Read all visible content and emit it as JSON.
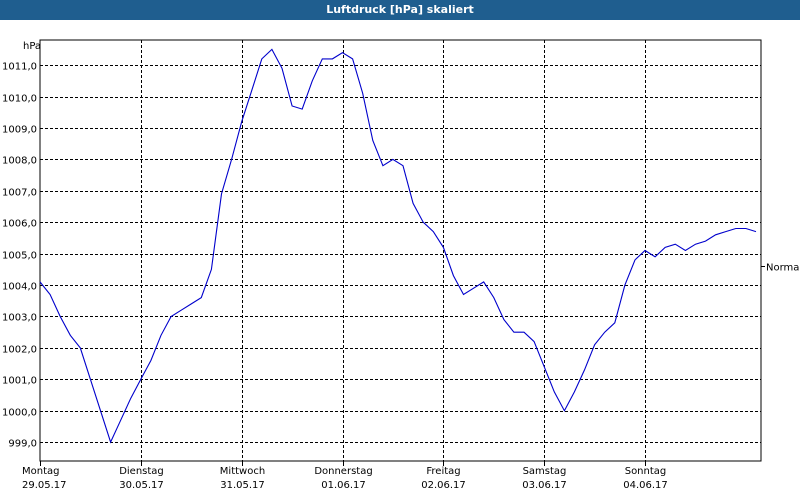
{
  "window": {
    "title": "Luftdruck [hPa] skaliert"
  },
  "chart_data": {
    "type": "line",
    "title": "Luftdruck [hPa] skaliert",
    "ylabel": "hPa",
    "ylim": [
      998.4,
      1011.8
    ],
    "yticks": [
      "999,0",
      "1000,0",
      "1001,0",
      "1002,0",
      "1003,0",
      "1004,0",
      "1005,0",
      "1006,0",
      "1007,0",
      "1008,0",
      "1009,0",
      "1010,0",
      "1011,0"
    ],
    "ytick_values": [
      999,
      1000,
      1001,
      1002,
      1003,
      1004,
      1005,
      1006,
      1007,
      1008,
      1009,
      1010,
      1011
    ],
    "xlim": [
      0,
      7.15
    ],
    "xticks": [
      {
        "day": "Montag",
        "date": "29.05.17"
      },
      {
        "day": "Dienstag",
        "date": "30.05.17"
      },
      {
        "day": "Mittwoch",
        "date": "31.05.17"
      },
      {
        "day": "Donnerstag",
        "date": "01.06.17"
      },
      {
        "day": "Freitag",
        "date": "02.06.17"
      },
      {
        "day": "Samstag",
        "date": "03.06.17"
      },
      {
        "day": "Sonntag",
        "date": "04.06.17"
      }
    ],
    "grid": true,
    "reference_label": "Normal",
    "reference_value": 1004.6,
    "series_color": "#0000cc",
    "series": [
      {
        "x": [
          0,
          0.1,
          0.2,
          0.3,
          0.4,
          0.5,
          0.6,
          0.7,
          0.8,
          0.9,
          1.0,
          1.1,
          1.2,
          1.3,
          1.4,
          1.5,
          1.6,
          1.7,
          1.8,
          1.9,
          2.0,
          2.1,
          2.2,
          2.3,
          2.4,
          2.5,
          2.6,
          2.7,
          2.8,
          2.9,
          3.0,
          3.1,
          3.2,
          3.3,
          3.4,
          3.5,
          3.6,
          3.7,
          3.8,
          3.9,
          4.0,
          4.1,
          4.2,
          4.3,
          4.4,
          4.5,
          4.6,
          4.7,
          4.8,
          4.9,
          5.0,
          5.1,
          5.2,
          5.3,
          5.4,
          5.5,
          5.6,
          5.7,
          5.8,
          5.9,
          6.0,
          6.1,
          6.2,
          6.3,
          6.4,
          6.5,
          6.6,
          6.7,
          6.8,
          6.9,
          7.0,
          7.1
        ],
        "y": [
          1004.1,
          1003.7,
          1003.0,
          1002.4,
          1002.0,
          1001.0,
          1000.0,
          999.0,
          999.7,
          1000.4,
          1001.0,
          1001.6,
          1002.4,
          1003.0,
          1003.2,
          1003.4,
          1003.6,
          1004.5,
          1006.9,
          1008.0,
          1009.2,
          1010.2,
          1011.2,
          1011.5,
          1010.9,
          1009.7,
          1009.6,
          1010.5,
          1011.2,
          1011.2,
          1011.4,
          1011.2,
          1010.1,
          1008.6,
          1007.8,
          1008.0,
          1007.8,
          1006.6,
          1006.0,
          1005.7,
          1005.2,
          1004.3,
          1003.7,
          1003.9,
          1004.1,
          1003.6,
          1002.9,
          1002.5,
          1002.5,
          1002.2,
          1001.4,
          1000.6,
          1000.0,
          1000.6,
          1001.3,
          1002.1,
          1002.5,
          1002.8,
          1004.0,
          1004.8,
          1005.1,
          1004.9,
          1005.2,
          1005.3,
          1005.1,
          1005.3,
          1005.4,
          1005.6,
          1005.7,
          1005.8,
          1005.8,
          1005.7
        ]
      }
    ]
  }
}
